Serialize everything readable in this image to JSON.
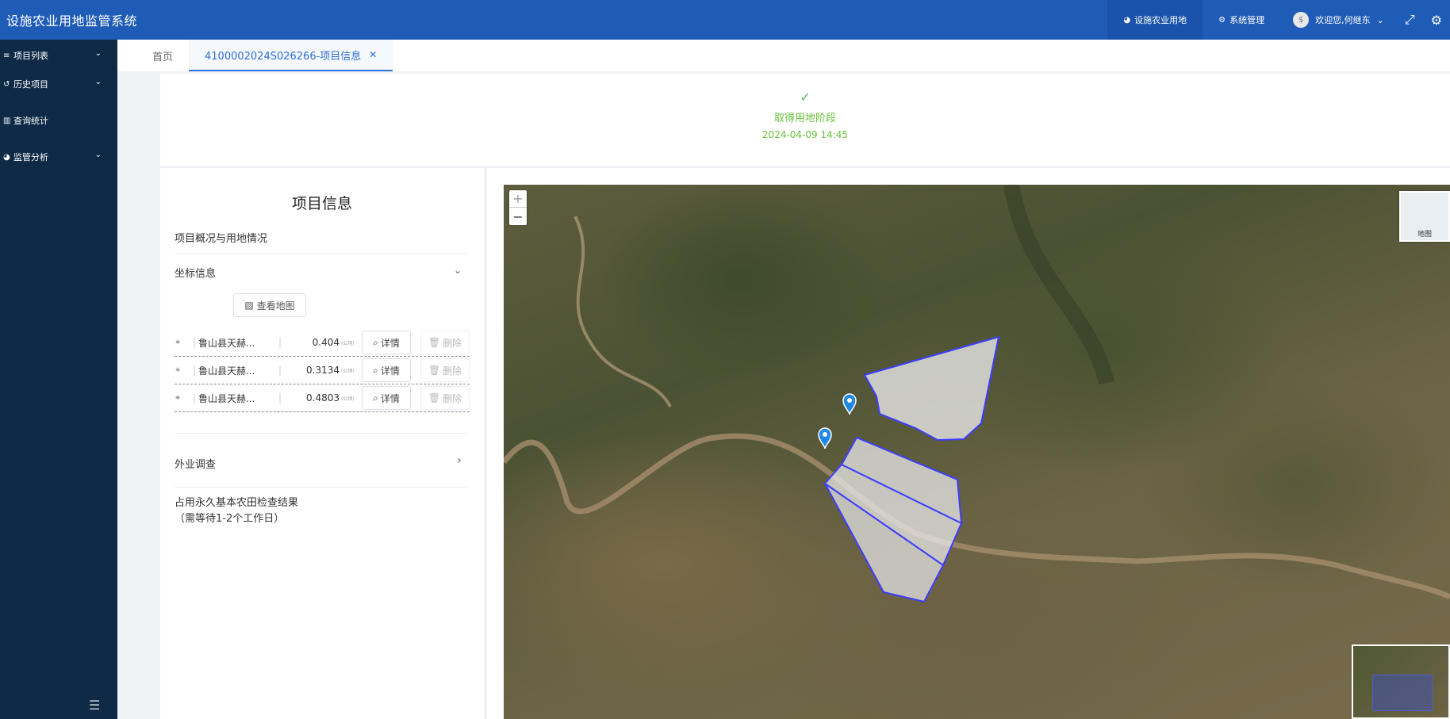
{
  "header": {
    "title": "设施农业用地监管系统",
    "nav": [
      {
        "label": "设施农业用地",
        "icon": "pie-chart-icon",
        "active": true
      },
      {
        "label": "系统管理",
        "icon": "gears-icon",
        "active": false
      }
    ],
    "user": {
      "avatar": "$",
      "greeting": "欢迎您,何继东"
    }
  },
  "sidebar": {
    "items": [
      {
        "label": "项目列表",
        "icon": "list-icon",
        "has_children": true
      },
      {
        "label": "历史项目",
        "icon": "history-icon",
        "has_children": true
      },
      {
        "label": "查询统计",
        "icon": "bar-chart-icon",
        "has_children": false
      },
      {
        "label": "监管分析",
        "icon": "pie-chart-icon",
        "has_children": true
      }
    ]
  },
  "tabs": [
    {
      "label": "首页",
      "active": false
    },
    {
      "label": "4100002024S026266-项目信息",
      "active": true,
      "closable": true
    }
  ],
  "status": {
    "check_icon": "✓",
    "stage": "取得用地阶段",
    "time": "2024-04-09 14:45",
    "color": "#67c23a"
  },
  "info": {
    "title": "项目信息",
    "overview": "项目概况与用地情况",
    "coord_section": "坐标信息",
    "view_map": "查看地图",
    "coords": [
      {
        "name": "鲁山县天赫...",
        "area": "0.404",
        "unit": "(公顷)",
        "detail": "详情",
        "delete": "删除"
      },
      {
        "name": "鲁山县天赫...",
        "area": "0.3134",
        "unit": "(公顷)",
        "detail": "详情",
        "delete": "删除"
      },
      {
        "name": "鲁山县天赫...",
        "area": "0.4803",
        "unit": "(公顷)",
        "detail": "详情",
        "delete": "删除"
      }
    ],
    "field_survey": "外业调查",
    "farmland_line1": "占用永久基本农田检查结果",
    "farmland_line2": "（需等待1-2个工作日）"
  },
  "map": {
    "zoom_in": "+",
    "zoom_out": "−",
    "layer_label": "地图",
    "parcel_color": "#3d3dff"
  }
}
